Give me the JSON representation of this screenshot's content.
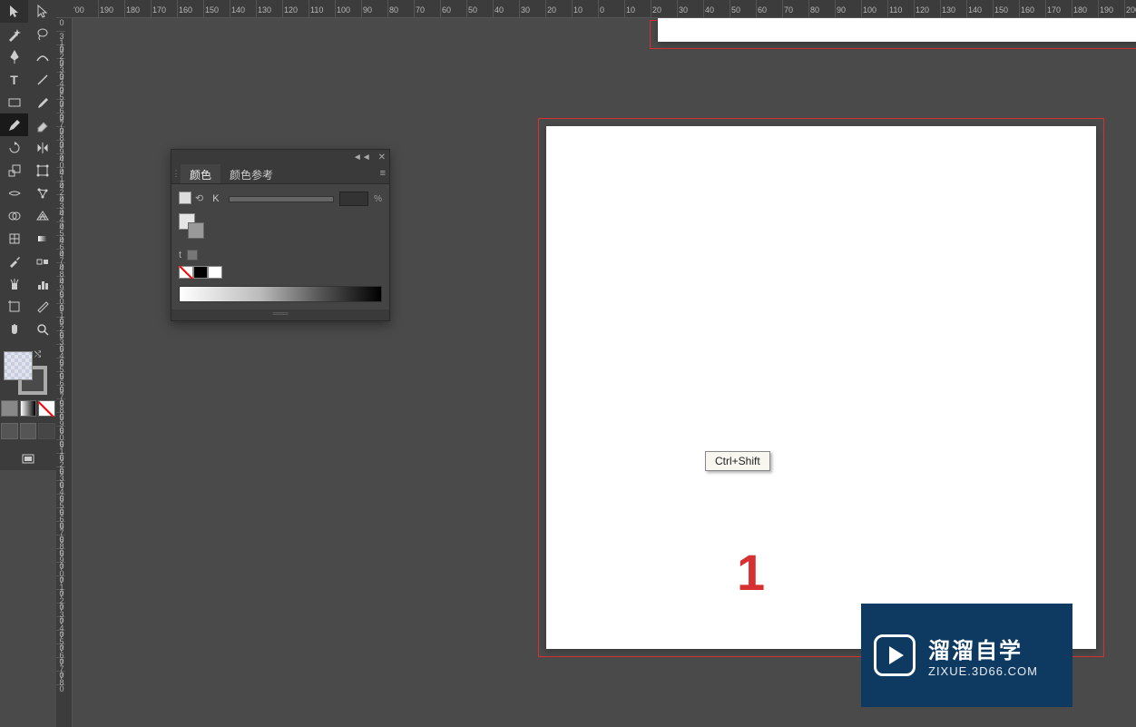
{
  "ruler": {
    "horizontal": [
      "'00",
      "190",
      "180",
      "170",
      "160",
      "150",
      "140",
      "130",
      "120",
      "110",
      "100",
      "90",
      "80",
      "70",
      "60",
      "50",
      "40",
      "30",
      "20",
      "10",
      "0",
      "10",
      "20",
      "30",
      "40",
      "50",
      "60",
      "70",
      "80",
      "90",
      "100",
      "110",
      "120",
      "130",
      "140",
      "150",
      "160",
      "170",
      "180",
      "190",
      "200",
      "2"
    ],
    "vertical": [
      "0",
      "310",
      "320",
      "330",
      "340",
      "350",
      "360",
      "370",
      "380",
      "390",
      "400",
      "410",
      "420",
      "430",
      "440",
      "450",
      "460",
      "470",
      "480",
      "490",
      "500",
      "510",
      "520",
      "530",
      "540",
      "550",
      "560",
      "570",
      "580",
      "590",
      "600",
      "610",
      "620",
      "630",
      "640",
      "650",
      "660",
      "670",
      "680",
      "690",
      "700",
      "710",
      "720",
      "730",
      "740",
      "750",
      "760",
      "770",
      "780"
    ]
  },
  "panel": {
    "tab_active": "颜色",
    "tab_inactive": "颜色参考",
    "slider_label": "K",
    "slider_value": "",
    "slider_unit": "%",
    "collapse": "◄◄",
    "close": "✕",
    "menu": "≡"
  },
  "artboard": {
    "number": "1",
    "tooltip": "Ctrl+Shift"
  },
  "watermark": {
    "title": "溜溜自学",
    "url": "ZIXUE.3D66.COM"
  },
  "tools": {
    "selection": "▲",
    "direct": "▶",
    "wand": "✦",
    "lasso": "◐",
    "pen": "✒",
    "curvature": "〰",
    "type": "T",
    "line": "／",
    "rect": "▭",
    "brush": "🖌",
    "pencil": "✎",
    "eraser": "◪",
    "rotate": "↻",
    "reflect": "⇄",
    "scale": "⤡",
    "freeform": "▨",
    "warp": "≋",
    "puppet": "✥",
    "shapebuilder": "◉",
    "perspective": "▦",
    "mesh": "▤",
    "gradient": "▮",
    "eyedropper": "✐",
    "measure": "↔",
    "blend": "◎",
    "symbol": "✿",
    "graph": "▥",
    "artboard": "▢",
    "slice": "▱",
    "hand": "✋",
    "zoom": "🔍"
  }
}
